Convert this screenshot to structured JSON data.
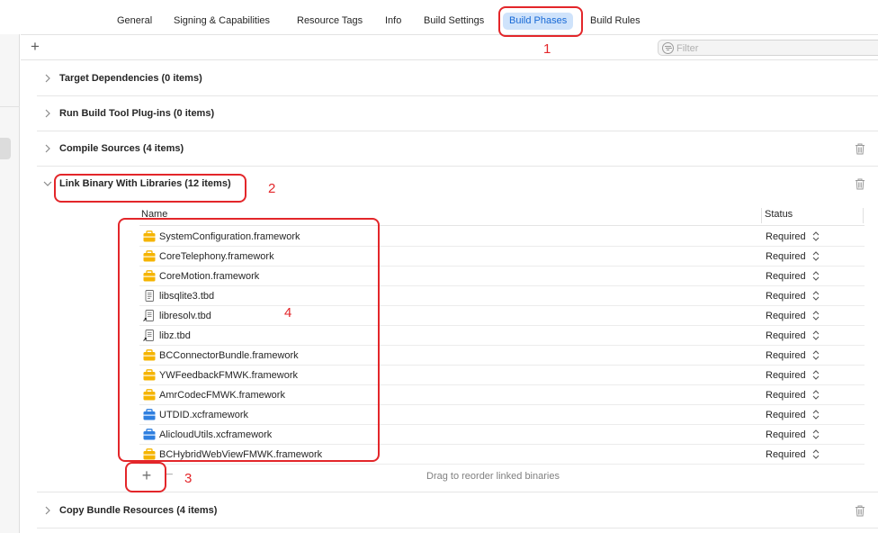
{
  "tabs": [
    {
      "label": "General",
      "active": false
    },
    {
      "label": "Signing & Capabilities",
      "active": false
    },
    {
      "label": "Resource Tags",
      "active": false
    },
    {
      "label": "Info",
      "active": false
    },
    {
      "label": "Build Settings",
      "active": false
    },
    {
      "label": "Build Phases",
      "active": true
    },
    {
      "label": "Build Rules",
      "active": false
    }
  ],
  "toolbar": {
    "add_label": "+",
    "filter_placeholder": "Filter"
  },
  "phases": {
    "target_dependencies": "Target Dependencies (0 items)",
    "run_build_tool_plugins": "Run Build Tool Plug-ins (0 items)",
    "compile_sources": "Compile Sources (4 items)",
    "link_binary": "Link Binary With Libraries (12 items)",
    "copy_bundle_resources": "Copy Bundle Resources (4 items)"
  },
  "libraries_table": {
    "col_name": "Name",
    "col_status": "Status",
    "rows": [
      {
        "name": "SystemConfiguration.framework",
        "status": "Required",
        "icon": "framework-icon"
      },
      {
        "name": "CoreTelephony.framework",
        "status": "Required",
        "icon": "framework-icon"
      },
      {
        "name": "CoreMotion.framework",
        "status": "Required",
        "icon": "framework-icon"
      },
      {
        "name": "libsqlite3.tbd",
        "status": "Required",
        "icon": "tbd-file-icon"
      },
      {
        "name": "libresolv.tbd",
        "status": "Required",
        "icon": "tbd-alias-icon"
      },
      {
        "name": "libz.tbd",
        "status": "Required",
        "icon": "tbd-alias-icon"
      },
      {
        "name": "BCConnectorBundle.framework",
        "status": "Required",
        "icon": "framework-icon"
      },
      {
        "name": "YWFeedbackFMWK.framework",
        "status": "Required",
        "icon": "framework-icon"
      },
      {
        "name": "AmrCodecFMWK.framework",
        "status": "Required",
        "icon": "framework-icon"
      },
      {
        "name": "UTDID.xcframework",
        "status": "Required",
        "icon": "xcframework-icon"
      },
      {
        "name": "AlicloudUtils.xcframework",
        "status": "Required",
        "icon": "xcframework-icon"
      },
      {
        "name": "BCHybridWebViewFMWK.framework",
        "status": "Required",
        "icon": "framework-icon"
      }
    ],
    "add_label": "+",
    "remove_label": "−",
    "drag_hint": "Drag to reorder linked binaries"
  },
  "annotations": {
    "one": "1",
    "two": "2",
    "three": "3",
    "four": "4",
    "color": "#e3262a"
  },
  "colors": {
    "accent": "#1769d6",
    "active_tab_bg": "#cfe3fb",
    "framework_icon": "#f5b400",
    "xcframework_icon": "#2f7fe0"
  }
}
